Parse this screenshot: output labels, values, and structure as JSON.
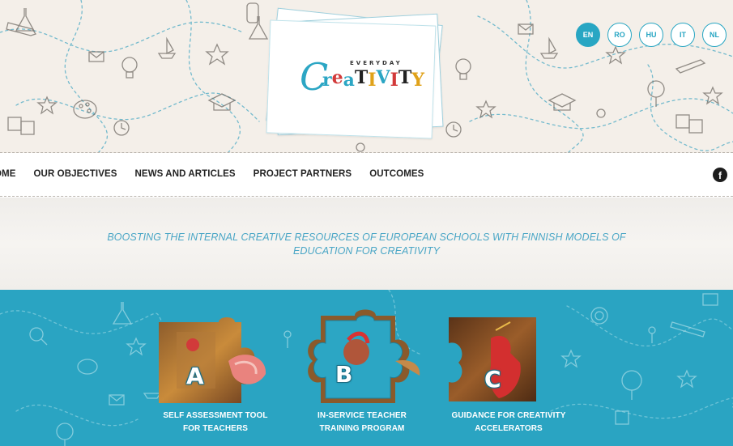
{
  "languages": [
    {
      "code": "EN",
      "active": true
    },
    {
      "code": "RO",
      "active": false
    },
    {
      "code": "HU",
      "active": false
    },
    {
      "code": "IT",
      "active": false
    },
    {
      "code": "NL",
      "active": false
    }
  ],
  "logo": {
    "everyday": "EVERYDAY",
    "c": "C",
    "rest": "reaTIVITY"
  },
  "nav": {
    "items": [
      "OME",
      "OUR OBJECTIVES",
      "NEWS AND ARTICLES",
      "PROJECT PARTNERS",
      "OUTCOMES"
    ],
    "facebook": "f"
  },
  "tagline": {
    "line1": "BOOSTING THE INTERNAL CREATIVE RESOURCES OF EUROPEAN SCHOOLS WITH FINNISH MODELS OF",
    "line2": "EDUCATION FOR CREATIVITY"
  },
  "outcomes": [
    {
      "letter": "A",
      "line1": "SELF ASSESSMENT TOOL",
      "line2": "FOR TEACHERS"
    },
    {
      "letter": "B",
      "line1": "IN-SERVICE TEACHER",
      "line2": "TRAINING PROGRAM"
    },
    {
      "letter": "C",
      "line1": "GUIDANCE FOR CREATIVITY",
      "line2": "ACCELERATORS"
    }
  ],
  "colors": {
    "accent": "#28a6c3",
    "teal_bg": "#2aa4c2",
    "header_bg": "#f4efe9",
    "tagline": "#4aa6c6"
  }
}
